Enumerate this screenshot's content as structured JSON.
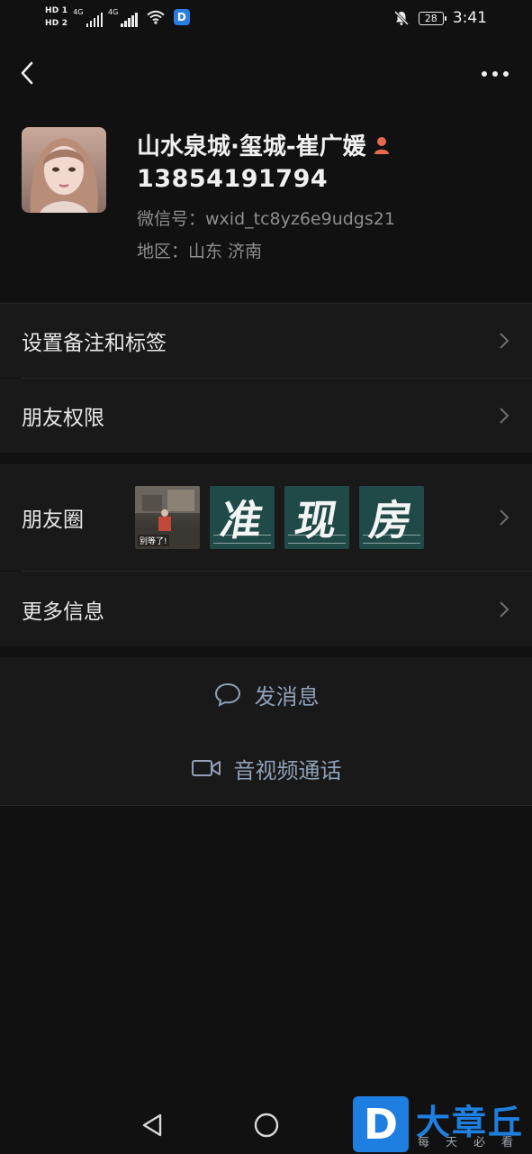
{
  "status_bar": {
    "hd1": "HD 1",
    "hd2": "HD 2",
    "net1": "4G",
    "net2": "4G",
    "battery": "28",
    "time": "3:41"
  },
  "profile": {
    "name": "山水泉城·玺城-崔广媛",
    "phone": "13854191794",
    "wechat_id": "微信号：wxid_tc8yz6e9udgs21",
    "region": "地区：山东  济南"
  },
  "menu": {
    "remarks_tags": "设置备注和标签",
    "friend_permissions": "朋友权限",
    "moments": "朋友圈",
    "more_info": "更多信息"
  },
  "moments_thumbs": {
    "thumb1_caption": "别等了!",
    "thumb2_char": "准",
    "thumb3_char": "现",
    "thumb4_char": "房"
  },
  "actions": {
    "send_message": "发消息",
    "av_call": "音视频通话"
  },
  "watermark": {
    "logo_letter": "D",
    "title": "大章丘",
    "subtitle": "每天必看"
  },
  "colors": {
    "background": "#111111",
    "row_bg": "#191919",
    "action_text": "#8ea0b8",
    "secondary_text": "#8e8e8e",
    "watermark_blue": "#1e7fe0"
  }
}
